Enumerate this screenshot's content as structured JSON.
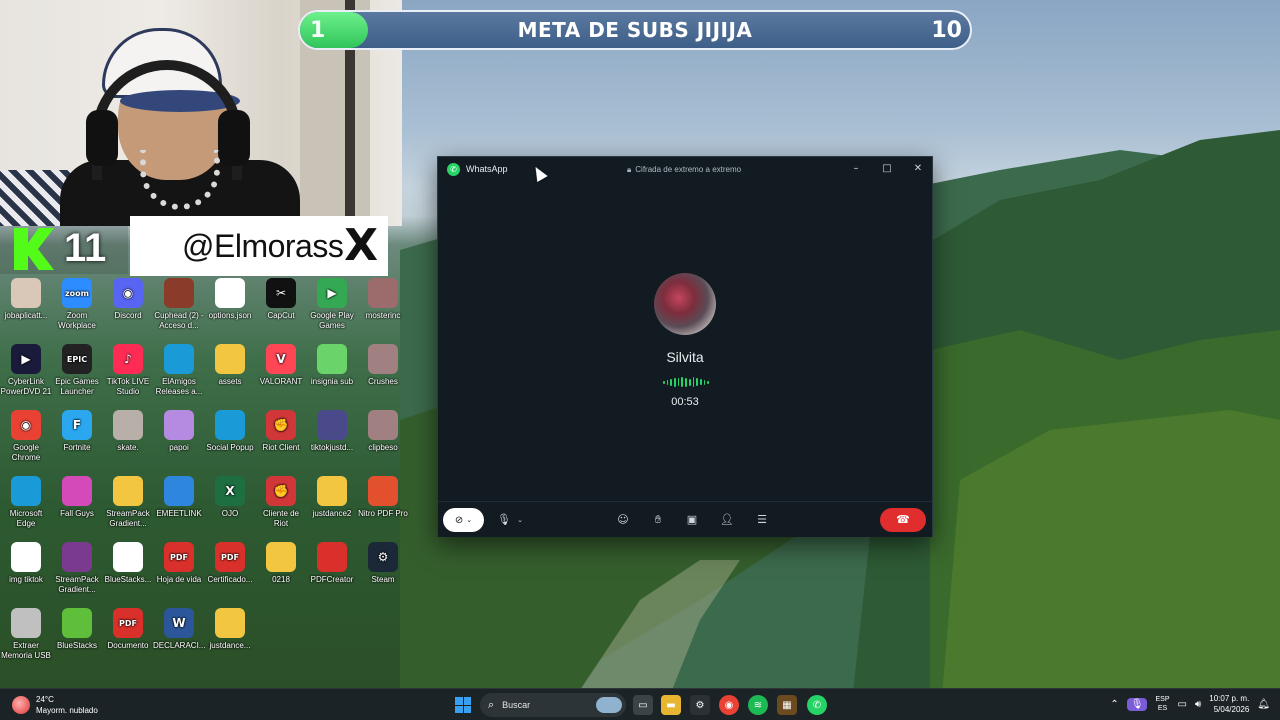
{
  "overlay": {
    "subs_current": "1",
    "subs_title": "META DE SUBS JIJIJA",
    "subs_goal": "10",
    "subs_progress_fraction": 0.1,
    "kick_count": "11",
    "x_handle": "@Elmorass",
    "x_logo": "X"
  },
  "desktop_icons": [
    {
      "label": "jobaplicatt...",
      "icon": "person-photo-icon",
      "color": "#d9c7b8"
    },
    {
      "label": "Zoom Workplace",
      "icon": "zoom-icon",
      "color": "#2d8cff",
      "glyph": "zoom"
    },
    {
      "label": "Discord",
      "icon": "discord-icon",
      "color": "#5865f2",
      "glyph": "◉"
    },
    {
      "label": "Cuphead (2) - Acceso d...",
      "icon": "cuphead-icon",
      "color": "#8a3b2a"
    },
    {
      "label": "options.json",
      "icon": "file-icon",
      "color": "#ffffff"
    },
    {
      "label": "CapCut",
      "icon": "capcut-icon",
      "color": "#111111",
      "glyph": "✂"
    },
    {
      "label": "Google Play Games",
      "icon": "play-games-icon",
      "color": "#34a853",
      "glyph": "▶"
    },
    {
      "label": "mosterinc",
      "icon": "mosterinc-icon",
      "color": "#9c6b6b"
    },
    {
      "label": "CyberLink PowerDVD 21",
      "icon": "powerdvd-icon",
      "color": "#1a1a3a",
      "glyph": "▶"
    },
    {
      "label": "Epic Games Launcher",
      "icon": "epic-games-icon",
      "color": "#222222",
      "glyph": "EPIC"
    },
    {
      "label": "TikTok LIVE Studio",
      "icon": "tiktok-live-icon",
      "color": "#fe2c55",
      "glyph": "♪"
    },
    {
      "label": "ElAmigos Releases a...",
      "icon": "edge-icon",
      "color": "#1a9bd7"
    },
    {
      "label": "assets",
      "icon": "folder-icon",
      "color": "#f3c642"
    },
    {
      "label": "VALORANT",
      "icon": "valorant-icon",
      "color": "#ff4655",
      "glyph": "V"
    },
    {
      "label": "insignia sub",
      "icon": "insignia-icon",
      "color": "#6ad36a"
    },
    {
      "label": "Crushes",
      "icon": "crushes-icon",
      "color": "#a08080"
    },
    {
      "label": "Google Chrome",
      "icon": "chrome-icon",
      "color": "#e94235",
      "glyph": "◉"
    },
    {
      "label": "Fortnite",
      "icon": "fortnite-icon",
      "color": "#2aa7ef",
      "glyph": "F"
    },
    {
      "label": "skate.",
      "icon": "skate-icon",
      "color": "#b8b0a8"
    },
    {
      "label": "papoi",
      "icon": "papoi-icon",
      "color": "#b48be0"
    },
    {
      "label": "Social Popup",
      "icon": "edge-icon",
      "color": "#1a9bd7"
    },
    {
      "label": "Riot Client",
      "icon": "riot-client-icon",
      "color": "#d13639",
      "glyph": "✊"
    },
    {
      "label": "tiktokjustd...",
      "icon": "tiktokjustd-icon",
      "color": "#4a4a8a"
    },
    {
      "label": "clipbeso",
      "icon": "clipbeso-icon",
      "color": "#a08080"
    },
    {
      "label": "Microsoft Edge",
      "icon": "edge-icon",
      "color": "#1a9bd7"
    },
    {
      "label": "Fall Guys",
      "icon": "fall-guys-icon",
      "color": "#d44ab8"
    },
    {
      "label": "StreamPack Gradient...",
      "icon": "folder-icon",
      "color": "#f3c642"
    },
    {
      "label": "EMEETLINK",
      "icon": "emeetlink-icon",
      "color": "#2f86de"
    },
    {
      "label": "OJO",
      "icon": "excel-icon",
      "color": "#1d6f42",
      "glyph": "X"
    },
    {
      "label": "Cliente de Riot",
      "icon": "riot-client-icon",
      "color": "#d13639",
      "glyph": "✊"
    },
    {
      "label": "justdance2",
      "icon": "zip-folder-icon",
      "color": "#f3c642"
    },
    {
      "label": "Nitro PDF Pro",
      "icon": "nitro-pdf-icon",
      "color": "#e2502d"
    },
    {
      "label": "img tiktok",
      "icon": "file-icon",
      "color": "#ffffff"
    },
    {
      "label": "StreamPack Gradient...",
      "icon": "winrar-icon",
      "color": "#7a3b8f"
    },
    {
      "label": "BlueStacks...",
      "icon": "file-icon",
      "color": "#ffffff"
    },
    {
      "label": "Hoja de vida",
      "icon": "pdf-icon",
      "color": "#d9302b",
      "glyph": "PDF"
    },
    {
      "label": "Certificado...",
      "icon": "pdf-icon",
      "color": "#d9302b",
      "glyph": "PDF"
    },
    {
      "label": "0218",
      "icon": "zip-folder-icon",
      "color": "#f3c642"
    },
    {
      "label": "PDFCreator",
      "icon": "pdfcreator-icon",
      "color": "#d9302b"
    },
    {
      "label": "Steam",
      "icon": "steam-icon",
      "color": "#1b2838",
      "glyph": "⚙"
    },
    {
      "label": "Extraer Memoria USB",
      "icon": "usb-icon",
      "color": "#c0c0c0"
    },
    {
      "label": "BlueStacks",
      "icon": "bluestacks-icon",
      "color": "#5fbf3a"
    },
    {
      "label": "Documento",
      "icon": "pdf-icon",
      "color": "#d9302b",
      "glyph": "PDF"
    },
    {
      "label": "DECLARACI...",
      "icon": "word-icon",
      "color": "#2b579a",
      "glyph": "W"
    },
    {
      "label": "justdance...",
      "icon": "zip-folder-icon",
      "color": "#f3c642"
    }
  ],
  "whatsapp": {
    "app_title": "WhatsApp",
    "encryption": "Cifrada de extremo a extremo",
    "contact_name": "Silvita",
    "call_timer": "00:53",
    "minimize": "–",
    "maximize": "□",
    "close": "✕"
  },
  "taskbar": {
    "weather_temp": "24°C",
    "weather_desc": "Mayorm. nublado",
    "search_placeholder": "Buscar",
    "lang_line1": "ESP",
    "lang_line2": "ES",
    "time": "10:07 p. m.",
    "date": "5/04/2026"
  }
}
